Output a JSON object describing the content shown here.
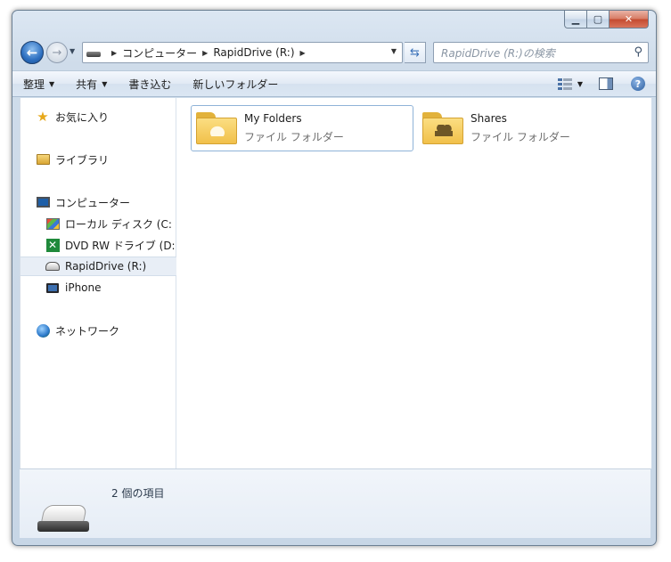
{
  "window": {
    "caption": {
      "minimize": "▁",
      "maximize": "▢",
      "close": "✕"
    }
  },
  "address_bar": {
    "crumbs": [
      "コンピューター",
      "RapidDrive (R:)"
    ]
  },
  "search": {
    "placeholder": "RapidDrive (R:)の検索"
  },
  "toolbar": {
    "organize": "整理",
    "share": "共有",
    "burn": "書き込む",
    "new_folder": "新しいフォルダー"
  },
  "sidebar": {
    "favorites": "お気に入り",
    "libraries": "ライブラリ",
    "computer": "コンピューター",
    "drives": [
      {
        "label": "ローカル ディスク (C:"
      },
      {
        "label": "DVD RW ドライブ (D:"
      },
      {
        "label": "RapidDrive (R:)"
      },
      {
        "label": "iPhone"
      }
    ],
    "network": "ネットワーク"
  },
  "files": [
    {
      "name": "My Folders",
      "type": "ファイル フォルダー",
      "badge": "cloud-icon"
    },
    {
      "name": "Shares",
      "type": "ファイル フォルダー",
      "badge": "people-icon"
    }
  ],
  "details": {
    "count": "2 個の項目"
  },
  "colors": {
    "accent": "#2d6fc0",
    "folder": "#f1c04a",
    "selection_border": "#8fb3d8"
  }
}
